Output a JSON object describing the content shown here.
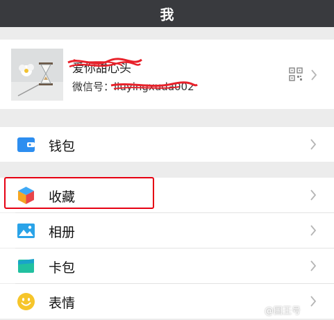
{
  "header": {
    "title": "我"
  },
  "profile": {
    "name": "爱你甜心头",
    "wechat_id": "微信号：liuyingxuda002"
  },
  "menu": {
    "wallet_label": "钱包",
    "favorites_label": "收藏",
    "album_label": "相册",
    "cards_label": "卡包",
    "stickers_label": "表情"
  },
  "watermark": {
    "text": "@国王号"
  },
  "colors": {
    "titlebar": "#393a3e",
    "background": "#ececec",
    "highlight_box": "#e60012",
    "scribble": "#e8212a",
    "wallet_icon": "#2d8ef0",
    "cards_icon": "#21c0a0",
    "stickers_icon": "#f6c52a"
  },
  "icons": {
    "wallet": "wallet-icon",
    "favorites": "cube-icon",
    "album": "photo-icon",
    "cards": "card-icon",
    "stickers": "smiley-icon",
    "qr": "qr-code-icon",
    "chevron": "chevron-right-icon"
  }
}
